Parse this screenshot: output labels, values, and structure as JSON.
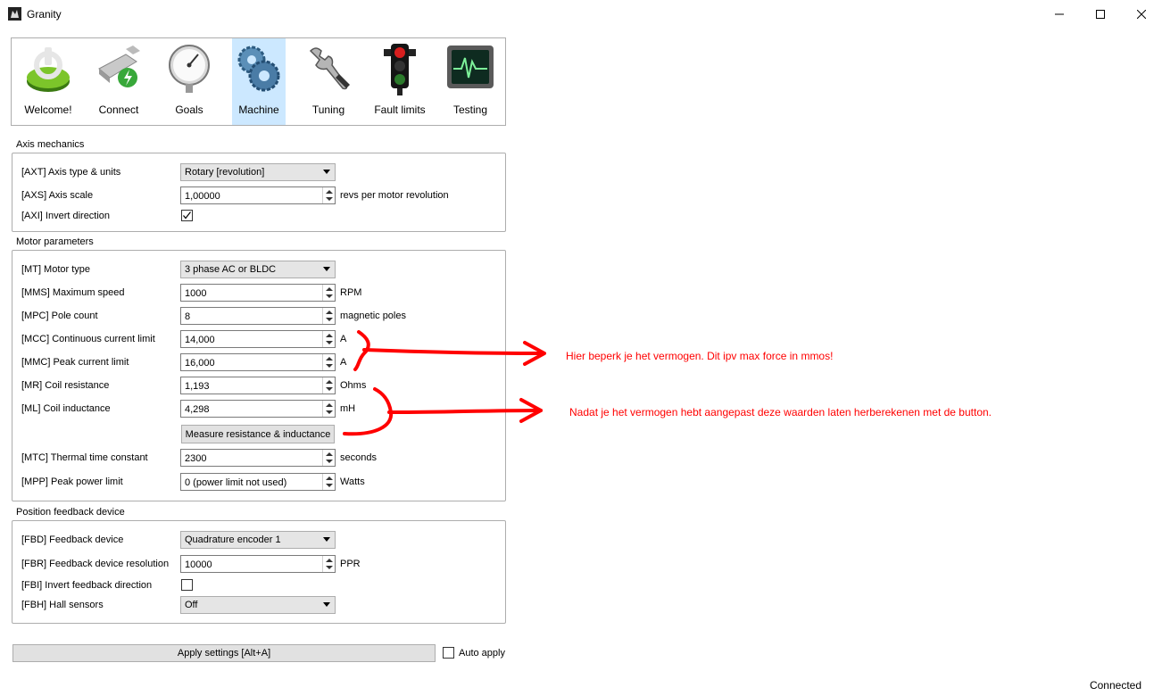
{
  "window": {
    "title": "Granity"
  },
  "toolbar": {
    "items": [
      {
        "label": "Welcome!",
        "icon": "power-icon"
      },
      {
        "label": "Connect",
        "icon": "connect-icon"
      },
      {
        "label": "Goals",
        "icon": "gauge-icon"
      },
      {
        "label": "Machine",
        "icon": "gears-icon",
        "active": true
      },
      {
        "label": "Tuning",
        "icon": "wrench-icon"
      },
      {
        "label": "Fault limits",
        "icon": "traffic-light-icon"
      },
      {
        "label": "Testing",
        "icon": "oscilloscope-icon"
      }
    ]
  },
  "axis": {
    "title": "Axis mechanics",
    "type_label": "[AXT] Axis type & units",
    "type_value": "Rotary [revolution]",
    "scale_label": "[AXS] Axis scale",
    "scale_value": "1,00000",
    "scale_unit": "revs per motor revolution",
    "invert_label": "[AXI] Invert direction",
    "invert_checked": true
  },
  "motor": {
    "title": "Motor parameters",
    "type_label": "[MT] Motor type",
    "type_value": "3 phase AC or BLDC",
    "speed_label": "[MMS] Maximum speed",
    "speed_value": "1000",
    "speed_unit": "RPM",
    "poles_label": "[MPC] Pole count",
    "poles_value": "8",
    "poles_unit": "magnetic poles",
    "mcc_label": "[MCC] Continuous current limit",
    "mcc_value": "14,000",
    "mcc_unit": "A",
    "mmc_label": "[MMC] Peak current limit",
    "mmc_value": "16,000",
    "mmc_unit": "A",
    "mr_label": "[MR] Coil resistance",
    "mr_value": "1,193",
    "mr_unit": "Ohms",
    "ml_label": "[ML] Coil inductance",
    "ml_value": "4,298",
    "ml_unit": "mH",
    "measure_button": "Measure resistance & inductance",
    "mtc_label": "[MTC] Thermal time constant",
    "mtc_value": "2300",
    "mtc_unit": "seconds",
    "mpp_label": "[MPP] Peak power limit",
    "mpp_value": "0 (power limit not used)",
    "mpp_unit": "Watts"
  },
  "feedback": {
    "title": "Position feedback device",
    "fbd_label": "[FBD] Feedback device",
    "fbd_value": "Quadrature encoder 1",
    "fbr_label": "[FBR] Feedback device resolution",
    "fbr_value": "10000",
    "fbr_unit": "PPR",
    "fbi_label": "[FBI] Invert feedback direction",
    "fbi_checked": false,
    "fbh_label": "[FBH] Hall sensors",
    "fbh_value": "Off"
  },
  "footer": {
    "apply_button": "Apply settings [Alt+A]",
    "auto_apply_label": "Auto apply",
    "status": "Connected"
  },
  "annotations": {
    "note1": "Hier beperk je het vermogen. Dit ipv max force in mmos!",
    "note2": "Nadat je het vermogen hebt aangepast deze waarden laten herberekenen met de button.",
    "color": "#ff0000"
  }
}
